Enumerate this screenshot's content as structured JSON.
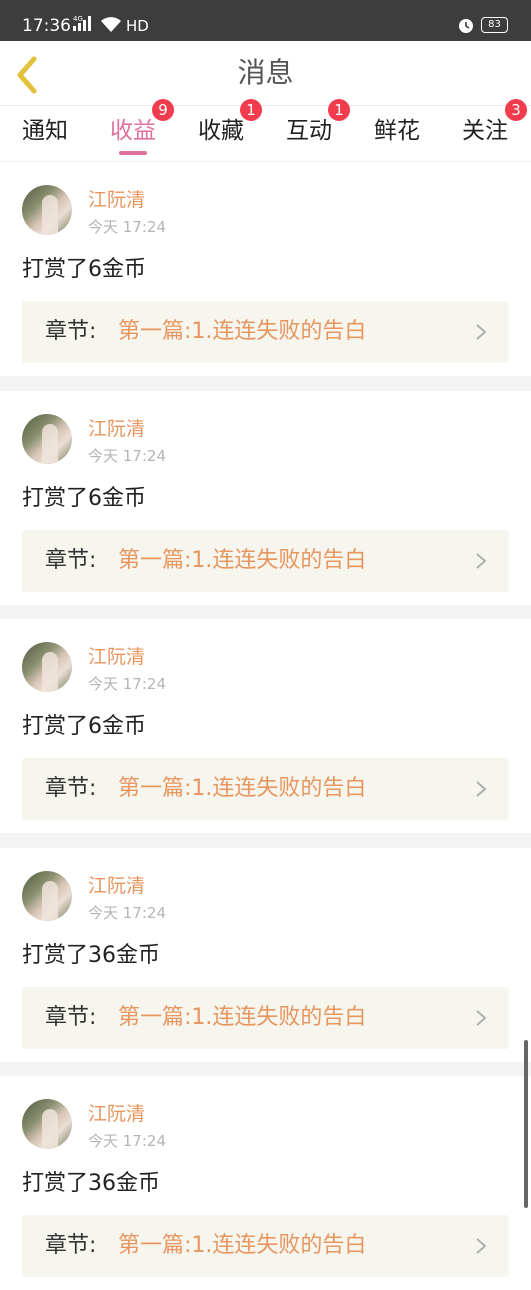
{
  "status_bar": {
    "time": "17:36",
    "network": "4G",
    "hd": "HD",
    "battery": "83"
  },
  "header": {
    "title": "消息"
  },
  "tabs": [
    {
      "label": "通知",
      "badge": ""
    },
    {
      "label": "收益",
      "badge": "9",
      "active": true
    },
    {
      "label": "收藏",
      "badge": "1"
    },
    {
      "label": "互动",
      "badge": "1"
    },
    {
      "label": "鲜花",
      "badge": ""
    },
    {
      "label": "关注",
      "badge": "3"
    }
  ],
  "items": [
    {
      "user": "江阮清",
      "time": "今天 17:24",
      "message": "打赏了6金币",
      "chapter_label": "章节:",
      "chapter_title": "第一篇:1.连连失败的告白"
    },
    {
      "user": "江阮清",
      "time": "今天 17:24",
      "message": "打赏了6金币",
      "chapter_label": "章节:",
      "chapter_title": "第一篇:1.连连失败的告白"
    },
    {
      "user": "江阮清",
      "time": "今天 17:24",
      "message": "打赏了6金币",
      "chapter_label": "章节:",
      "chapter_title": "第一篇:1.连连失败的告白"
    },
    {
      "user": "江阮清",
      "time": "今天 17:24",
      "message": "打赏了36金币",
      "chapter_label": "章节:",
      "chapter_title": "第一篇:1.连连失败的告白"
    },
    {
      "user": "江阮清",
      "time": "今天 17:24",
      "message": "打赏了36金币",
      "chapter_label": "章节:",
      "chapter_title": "第一篇:1.连连失败的告白"
    }
  ],
  "colors": {
    "accent_pink": "#e0709c",
    "accent_orange": "#e8965f",
    "badge_red": "#f03c4c",
    "back_arrow": "#e2c23a"
  },
  "icons": {
    "back": "chevron-left-icon",
    "row_arrow": "chevron-right-icon",
    "alarm": "alarm-icon",
    "wifi": "wifi-icon",
    "signal": "signal-icon",
    "battery": "battery-icon"
  }
}
